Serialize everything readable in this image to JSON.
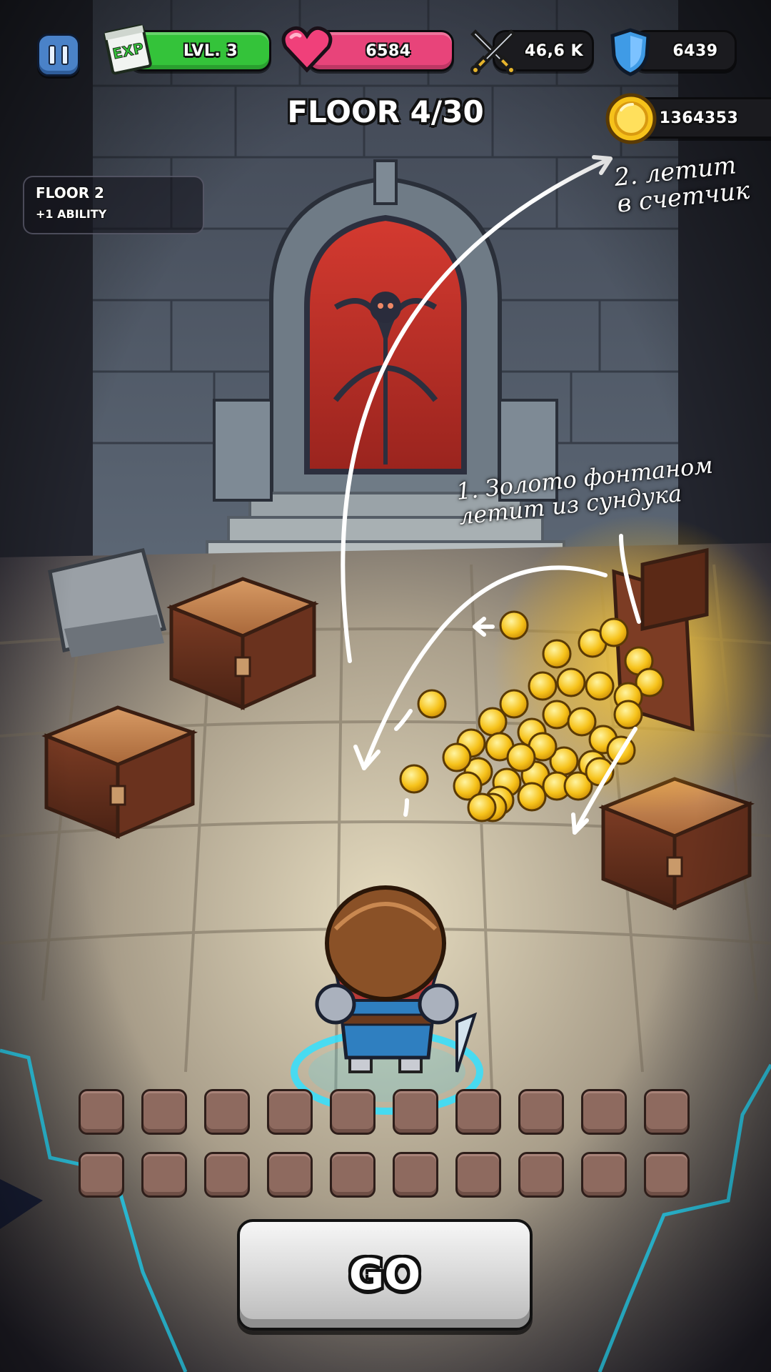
{
  "hud": {
    "exp": {
      "badge": "EXP",
      "level": "LVL. 3",
      "fill": 1.0,
      "color": "#34c33a"
    },
    "health": {
      "value": "6584",
      "fill": 1.0,
      "color": "#e8447a"
    },
    "attack": {
      "value": "46,6 K"
    },
    "defense": {
      "value": "6439"
    },
    "gold": {
      "value": "1364353"
    }
  },
  "floor": {
    "title": "FLOOR 4/30"
  },
  "floor_panel": {
    "line1": "FLOOR 2",
    "line2": "+1 ABILITY"
  },
  "annotations": {
    "note1": "1. Золото фонтаном\nлетит из сундука",
    "note2": "2. летит\nв счетчик"
  },
  "inventory": {
    "rows": 2,
    "slots_per_row": 10
  },
  "go_button": {
    "label": "GO"
  },
  "colors": {
    "accent_cyan": "#33e0ff",
    "gold": "#f6c21a",
    "door_red": "#c3322c"
  }
}
